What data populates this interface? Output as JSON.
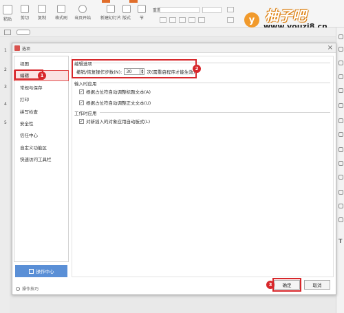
{
  "ribbon": {
    "buttons": [
      {
        "label": "粘贴"
      },
      {
        "label": "剪切"
      },
      {
        "label": "复制"
      },
      {
        "label": "格式刷"
      },
      {
        "label": "当页开始"
      },
      {
        "label": "新建幻灯片"
      },
      {
        "label": "版式"
      },
      {
        "label": "节"
      }
    ],
    "reset_label": "重置"
  },
  "logo": {
    "letter": "y",
    "name": "柚子吧",
    "url": "www.youzi8.cn"
  },
  "left_rail": {
    "numbers": [
      "1",
      "2",
      "3",
      "4",
      "5"
    ]
  },
  "dialog": {
    "title": "选项",
    "close": "×",
    "nav": [
      "视图",
      "编辑",
      "常规与保存",
      "打印",
      "拼写检查",
      "安全性",
      "信任中心",
      "自定义功能区",
      "快速访问工具栏"
    ],
    "operation_center": "操作中心",
    "operation_tips": "操作技巧",
    "sections": {
      "edit_options": {
        "title": "编辑选项",
        "undo_label": "撤销/恢复操作步数(N):",
        "undo_value": "30",
        "undo_suffix": "次(需重启程序才能生效)"
      },
      "input_apply": {
        "title": "输入时应用",
        "items": [
          {
            "label": "根据占位符自动调整标题文本(A)",
            "checked": true
          },
          {
            "label": "根据占位符自动调整正文文本(U)",
            "checked": true
          }
        ]
      },
      "work_apply": {
        "title": "工作时应用",
        "items": [
          {
            "label": "对新插入的对象应用自动板式(L)",
            "checked": true
          }
        ]
      }
    },
    "ok": "确定",
    "cancel": "取消"
  },
  "annotations": {
    "badge1": "1",
    "badge2": "2",
    "badge3": "3",
    "color": "#d7272b"
  }
}
